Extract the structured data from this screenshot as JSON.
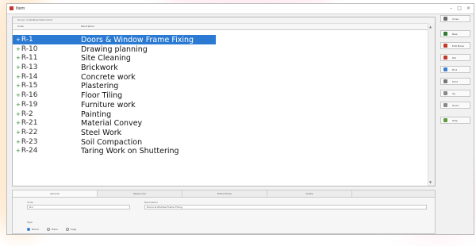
{
  "window": {
    "title": "Item",
    "controls": [
      "–",
      "□",
      "×"
    ]
  },
  "tree": {
    "group_label": "Group: Code/Description/Unit",
    "columns": {
      "code": "Code",
      "description": "Description"
    },
    "rows": [
      {
        "code": "R-1",
        "description": "Doors & Window Frame Fixing",
        "selected": true
      },
      {
        "code": "R-10",
        "description": "Drawing planning"
      },
      {
        "code": "R-11",
        "description": "Site Cleaning"
      },
      {
        "code": "R-13",
        "description": "Brickwork"
      },
      {
        "code": "R-14",
        "description": "Concrete work"
      },
      {
        "code": "R-15",
        "description": "Plastering"
      },
      {
        "code": "R-16",
        "description": "Floor Tiling"
      },
      {
        "code": "R-19",
        "description": "Furniture work"
      },
      {
        "code": "R-2",
        "description": "Painting"
      },
      {
        "code": "R-21",
        "description": "Material Convey"
      },
      {
        "code": "R-22",
        "description": "Steel Work"
      },
      {
        "code": "R-23",
        "description": "Soil Compaction"
      },
      {
        "code": "R-24",
        "description": "Taring Work on Shuttering"
      }
    ]
  },
  "side_buttons": [
    {
      "label": "Close",
      "color": "#6a6a6a"
    },
    {
      "label": "New",
      "color": "#2e7d32"
    },
    {
      "label": "Edit Mode",
      "color": "#c0392b"
    },
    {
      "label": "Del",
      "color": "#c0392b"
    },
    {
      "label": "Find",
      "color": "#3a7fd2"
    },
    {
      "label": "Print",
      "color": "#777777"
    },
    {
      "label": "Up",
      "color": "#888888"
    },
    {
      "label": "Down",
      "color": "#888888"
    },
    {
      "label": "Help",
      "color": "#5b9b3b"
    }
  ],
  "bottom": {
    "tabs": [
      "General",
      "Resources",
      "Extra Prices",
      "Quote"
    ],
    "code_label": "Code",
    "code_value": "R-1",
    "desc_label": "Description",
    "desc_value": "Doors & Window Frame Fixing",
    "radio_label": "Type",
    "radios": [
      {
        "label": "Doors",
        "on": true
      },
      {
        "label": "Trans",
        "on": false
      },
      {
        "label": "Copy",
        "on": false
      }
    ]
  }
}
